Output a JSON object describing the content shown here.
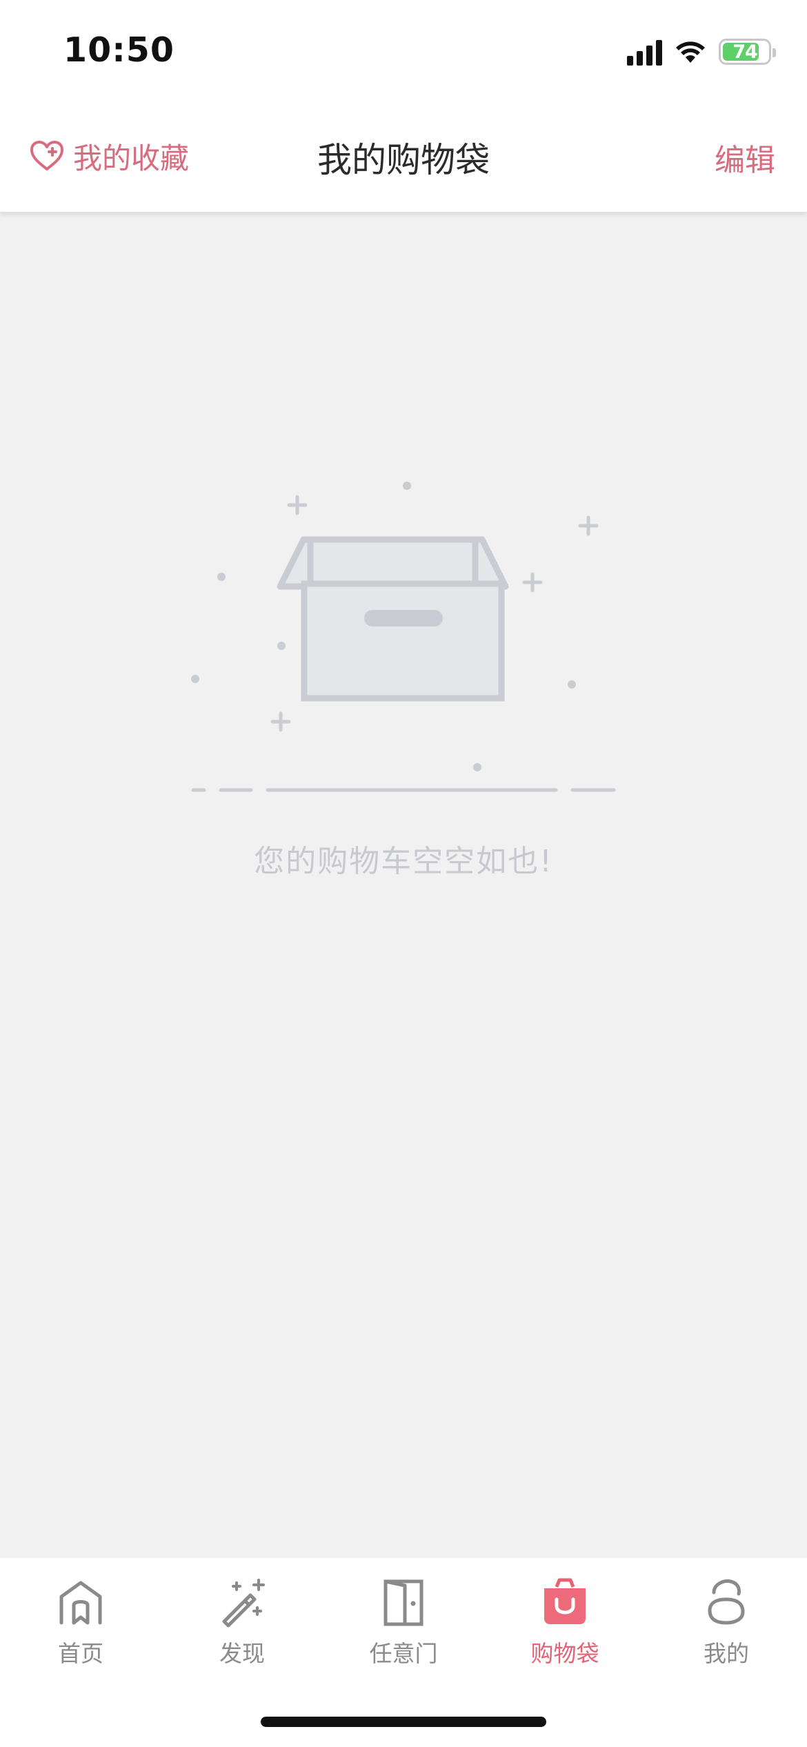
{
  "status_bar": {
    "time": "10:50",
    "battery_level": "74",
    "battery_charging": true,
    "signal_icon": "cellular-signal-icon",
    "wifi_icon": "wifi-icon"
  },
  "nav": {
    "favorites_label": "我的收藏",
    "favorites_icon": "heart-plus-icon",
    "title": "我的购物袋",
    "edit_label": "编辑"
  },
  "empty_state": {
    "illustration_icon": "empty-box-icon",
    "message": "您的购物车空空如也!"
  },
  "tab_bar": {
    "tabs": [
      {
        "label": "首页",
        "icon": "home-icon",
        "active": false
      },
      {
        "label": "发现",
        "icon": "magic-wand-icon",
        "active": false
      },
      {
        "label": "任意门",
        "icon": "door-icon",
        "active": false
      },
      {
        "label": "购物袋",
        "icon": "shopping-bag-icon",
        "active": true
      },
      {
        "label": "我的",
        "icon": "profile-icon",
        "active": false
      }
    ]
  },
  "colors": {
    "accent": "#d76c7f",
    "tab_active": "#e46475",
    "tab_inactive": "#8a8a8a",
    "background": "#f1f1f2",
    "illustration": "#c9ccd3"
  }
}
